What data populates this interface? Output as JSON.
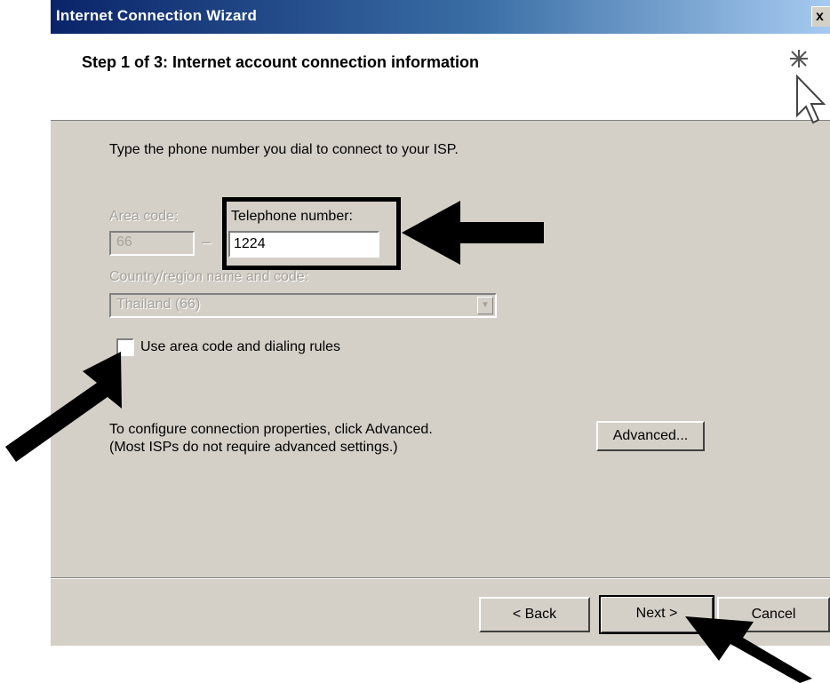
{
  "window": {
    "title": "Internet Connection Wizard",
    "close_glyph": "x"
  },
  "header": {
    "step_title": "Step 1 of 3: Internet account connection information"
  },
  "body": {
    "instruction": "Type the phone number you dial to connect to your ISP.",
    "area_code": {
      "label": "Area code:",
      "value": "66",
      "enabled": false
    },
    "separator": "–",
    "telephone": {
      "label": "Telephone number:",
      "value": "1224",
      "enabled": true
    },
    "country": {
      "label": "Country/region name and code:",
      "selected": "Thailand (66)",
      "enabled": false
    },
    "use_dialing_rules": {
      "label": "Use area code and dialing rules",
      "checked": false
    },
    "config_text": {
      "line1": "To configure connection properties, click Advanced.",
      "line2": "(Most ISPs do not require advanced settings.)"
    },
    "advanced_button": "Advanced..."
  },
  "footer": {
    "back_button": "< Back",
    "next_button": "Next >",
    "cancel_button": "Cancel"
  },
  "annotations": {
    "arrow_color": "#000000",
    "arrows": [
      "telephone-number-arrow",
      "checkbox-arrow",
      "next-button-arrow"
    ]
  }
}
